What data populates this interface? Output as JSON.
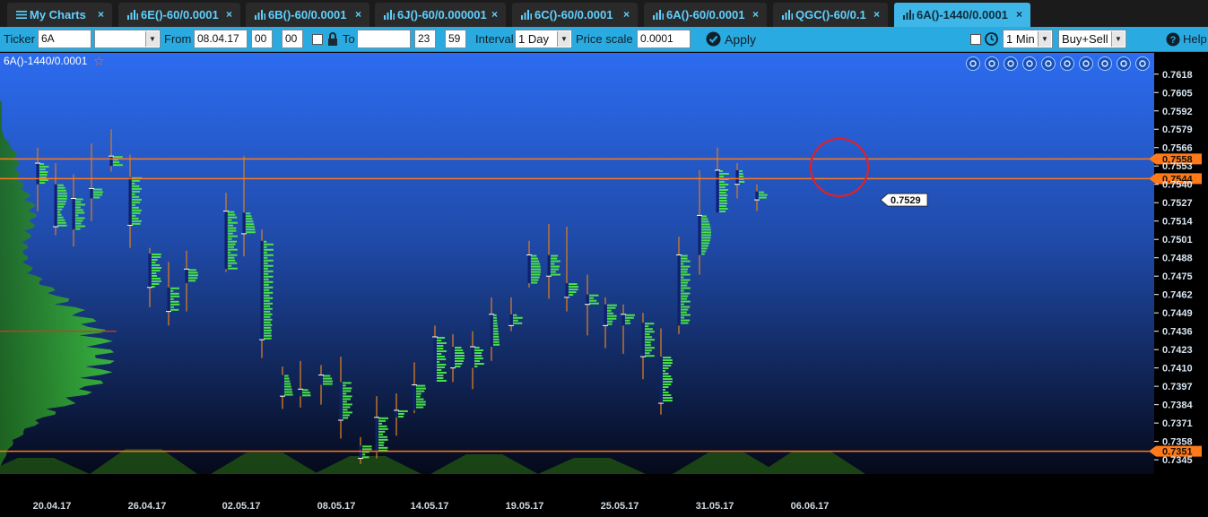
{
  "tabs": [
    {
      "label": "My Charts",
      "icon": "list-icon",
      "active": false
    },
    {
      "label": "6E()-60/0.0001",
      "icon": "bar-chart-icon",
      "active": false
    },
    {
      "label": "6B()-60/0.0001",
      "icon": "bar-chart-icon",
      "active": false
    },
    {
      "label": "6J()-60/0.000001",
      "icon": "bar-chart-icon",
      "active": false
    },
    {
      "label": "6C()-60/0.0001",
      "icon": "bar-chart-icon",
      "active": false
    },
    {
      "label": "6A()-60/0.0001",
      "icon": "bar-chart-icon",
      "active": false
    },
    {
      "label": "QGC()-60/0.1",
      "icon": "bar-chart-icon",
      "active": false
    },
    {
      "label": "6A()-1440/0.0001",
      "icon": "bar-chart-icon",
      "active": true
    }
  ],
  "toolbar": {
    "ticker_label": "Ticker",
    "ticker_value": "6A",
    "ticker_select_value": "",
    "from_label": "From",
    "from_date": "08.04.17",
    "from_hour": "00",
    "from_min": "00",
    "to_label": "To",
    "to_date": "",
    "to_hour": "23",
    "to_min": "59",
    "interval_label": "Interval",
    "interval_value": "1 Day",
    "price_scale_label": "Price scale",
    "price_scale_value": "0.0001",
    "apply_label": "Apply",
    "timeframe_value": "1 Min",
    "side_value": "Buy+Sell",
    "help_label": "Help"
  },
  "chart": {
    "title": "6A()-1440/0.0001",
    "colors": {
      "bg_top": "#2c6cf0",
      "bg_bottom": "#05091a",
      "level_line": "#ff7a1a",
      "highlight_circle": "#e0202a",
      "profile": "#3cc23c",
      "volume": "#1f4d14"
    },
    "price_ticks": [
      "0.7618",
      "0.7605",
      "0.7592",
      "0.7579",
      "0.7566",
      "0.7553",
      "0.7540",
      "0.7527",
      "0.7514",
      "0.7501",
      "0.7488",
      "0.7475",
      "0.7462",
      "0.7449",
      "0.7436",
      "0.7423",
      "0.7410",
      "0.7397",
      "0.7384",
      "0.7371",
      "0.7358",
      "0.7345"
    ],
    "date_ticks": [
      "20.04.17",
      "26.04.17",
      "02.05.17",
      "08.05.17",
      "14.05.17",
      "19.05.17",
      "25.05.17",
      "31.05.17",
      "06.06.17"
    ],
    "level_lines": [
      0.7558,
      0.7544,
      0.7351
    ],
    "level_labels": [
      "0.7558",
      "0.7544",
      "0.7351"
    ],
    "current_price": 0.7529,
    "current_price_label": "0.7529",
    "toolbar_icons": [
      "zoom-fit-icon",
      "zoom-in-icon",
      "zoom-out-icon",
      "grid-icon",
      "draw-icon",
      "refresh-icon",
      "settings-icon",
      "fullscreen-icon",
      "close-icon",
      "dropdown-icon"
    ]
  },
  "chart_data": {
    "type": "candlestick-footprint",
    "title": "6A()-1440/0.0001",
    "xlabel": "",
    "ylabel": "",
    "ylim": [
      0.734,
      0.7628
    ],
    "bars": [
      {
        "date": "19.04.17",
        "low": 0.7521,
        "high": 0.7566,
        "open": 0.754,
        "close": 0.7555
      },
      {
        "date": "20.04.17",
        "low": 0.7504,
        "high": 0.7555,
        "open": 0.754,
        "close": 0.751
      },
      {
        "date": "21.04.17",
        "low": 0.7496,
        "high": 0.7547,
        "open": 0.7508,
        "close": 0.753
      },
      {
        "date": "24.04.17",
        "low": 0.7514,
        "high": 0.7569,
        "open": 0.753,
        "close": 0.7537
      },
      {
        "date": "25.04.17",
        "low": 0.7549,
        "high": 0.7579,
        "open": 0.7553,
        "close": 0.756
      },
      {
        "date": "26.04.17",
        "low": 0.7495,
        "high": 0.7561,
        "open": 0.7545,
        "close": 0.7511
      },
      {
        "date": "27.04.17",
        "low": 0.7453,
        "high": 0.7495,
        "open": 0.7491,
        "close": 0.7467
      },
      {
        "date": "28.04.17",
        "low": 0.744,
        "high": 0.7485,
        "open": 0.7467,
        "close": 0.745
      },
      {
        "date": "01.05.17",
        "low": 0.745,
        "high": 0.7493,
        "open": 0.747,
        "close": 0.748
      },
      {
        "date": "02.05.17",
        "low": 0.7478,
        "high": 0.7534,
        "open": 0.748,
        "close": 0.7521
      },
      {
        "date": "03.05.17",
        "low": 0.7489,
        "high": 0.756,
        "open": 0.752,
        "close": 0.7505
      },
      {
        "date": "04.05.17",
        "low": 0.7417,
        "high": 0.7508,
        "open": 0.75,
        "close": 0.743
      },
      {
        "date": "05.05.17",
        "low": 0.7381,
        "high": 0.7411,
        "open": 0.7405,
        "close": 0.739
      },
      {
        "date": "08.05.17",
        "low": 0.7382,
        "high": 0.7415,
        "open": 0.739,
        "close": 0.7395
      },
      {
        "date": "09.05.17",
        "low": 0.7384,
        "high": 0.7412,
        "open": 0.7398,
        "close": 0.7405
      },
      {
        "date": "10.05.17",
        "low": 0.736,
        "high": 0.7418,
        "open": 0.74,
        "close": 0.7373
      },
      {
        "date": "11.05.17",
        "low": 0.7342,
        "high": 0.7361,
        "open": 0.7355,
        "close": 0.7346
      },
      {
        "date": "12.05.17",
        "low": 0.7346,
        "high": 0.739,
        "open": 0.735,
        "close": 0.7375
      },
      {
        "date": "15.05.17",
        "low": 0.7362,
        "high": 0.7392,
        "open": 0.7375,
        "close": 0.738
      },
      {
        "date": "16.05.17",
        "low": 0.7378,
        "high": 0.7414,
        "open": 0.738,
        "close": 0.7398
      },
      {
        "date": "17.05.17",
        "low": 0.7407,
        "high": 0.744,
        "open": 0.74,
        "close": 0.7432
      },
      {
        "date": "18.05.17",
        "low": 0.74,
        "high": 0.7434,
        "open": 0.7425,
        "close": 0.741
      },
      {
        "date": "19.05.17",
        "low": 0.7395,
        "high": 0.7436,
        "open": 0.741,
        "close": 0.7425
      },
      {
        "date": "22.05.17",
        "low": 0.7415,
        "high": 0.746,
        "open": 0.7425,
        "close": 0.7448
      },
      {
        "date": "23.05.17",
        "low": 0.7436,
        "high": 0.746,
        "open": 0.7448,
        "close": 0.744
      },
      {
        "date": "24.05.17",
        "low": 0.7467,
        "high": 0.75,
        "open": 0.747,
        "close": 0.749
      },
      {
        "date": "25.05.17",
        "low": 0.7459,
        "high": 0.7512,
        "open": 0.749,
        "close": 0.7475
      },
      {
        "date": "26.05.17",
        "low": 0.745,
        "high": 0.751,
        "open": 0.747,
        "close": 0.746
      },
      {
        "date": "29.05.17",
        "low": 0.7433,
        "high": 0.7476,
        "open": 0.7462,
        "close": 0.7455
      },
      {
        "date": "30.05.17",
        "low": 0.7424,
        "high": 0.746,
        "open": 0.7455,
        "close": 0.744
      },
      {
        "date": "31.05.17",
        "low": 0.742,
        "high": 0.7455,
        "open": 0.744,
        "close": 0.7448
      },
      {
        "date": "01.06.17",
        "low": 0.7402,
        "high": 0.7449,
        "open": 0.7442,
        "close": 0.7418
      },
      {
        "date": "02.06.17",
        "low": 0.7377,
        "high": 0.7438,
        "open": 0.7418,
        "close": 0.7385
      },
      {
        "date": "05.06.17",
        "low": 0.7434,
        "high": 0.7503,
        "open": 0.744,
        "close": 0.749
      },
      {
        "date": "06.06.17",
        "low": 0.7476,
        "high": 0.755,
        "open": 0.749,
        "close": 0.7518
      },
      {
        "date": "07.06.17",
        "low": 0.7537,
        "high": 0.7566,
        "open": 0.752,
        "close": 0.755
      },
      {
        "date": "08.06.17",
        "low": 0.753,
        "high": 0.7555,
        "open": 0.755,
        "close": 0.754
      },
      {
        "date": "09.06.17",
        "low": 0.7521,
        "high": 0.754,
        "open": 0.7535,
        "close": 0.7529
      }
    ],
    "horizontal_levels": [
      0.7558,
      0.7544,
      0.7351
    ],
    "last_price": 0.7529
  }
}
